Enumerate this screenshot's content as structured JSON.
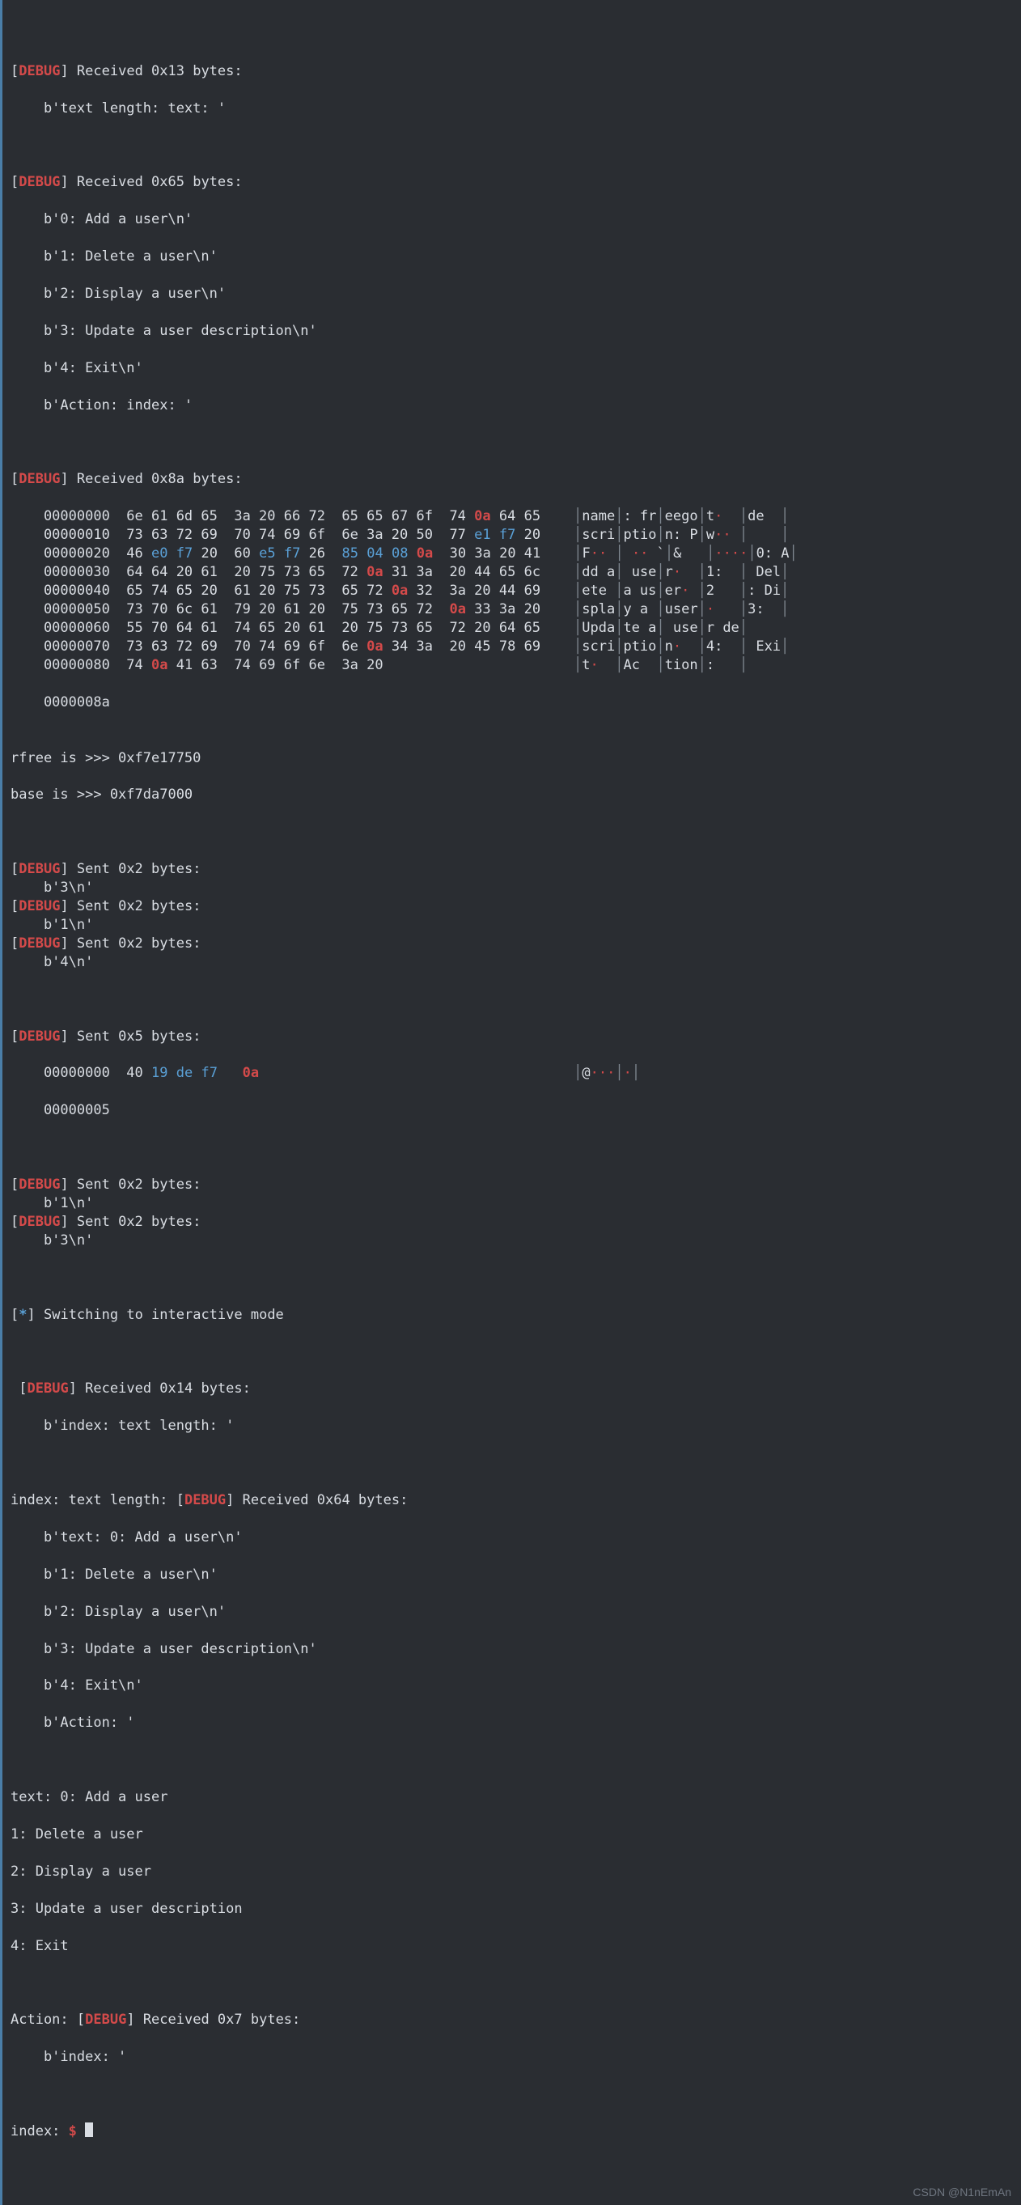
{
  "ansi": {
    "brL": "[",
    "brR": "]",
    "debug": "DEBUG",
    "star": "*"
  },
  "l1": " Received 0x13 bytes:",
  "l1b": "    b'text length: text: '",
  "l2": " Received 0x65 bytes:",
  "menu_raw": [
    "    b'0: Add a user\\n'",
    "    b'1: Delete a user\\n'",
    "    b'2: Display a user\\n'",
    "    b'3: Update a user description\\n'",
    "    b'4: Exit\\n'",
    "    b'Action: index: '"
  ],
  "l3": " Received 0x8a bytes:",
  "hex_rows": [
    {
      "off": "00000000",
      "g": [
        [
          "6e",
          "61",
          "6d",
          "65"
        ],
        [
          "3a",
          "20",
          "66",
          "72"
        ],
        [
          "65",
          "65",
          "67",
          "6f"
        ],
        [
          "74",
          "0a",
          "64",
          "65"
        ]
      ],
      "a": [
        "name",
        ": fr",
        "eego",
        "t",
        "de"
      ]
    },
    {
      "off": "00000010",
      "g": [
        [
          "73",
          "63",
          "72",
          "69"
        ],
        [
          "70",
          "74",
          "69",
          "6f"
        ],
        [
          "6e",
          "3a",
          "20",
          "50"
        ],
        [
          "77",
          "e1",
          "f7",
          "20"
        ]
      ],
      "a": [
        "scri",
        "ptio",
        "n: P",
        "w",
        "  "
      ]
    },
    {
      "off": "00000020",
      "g": [
        [
          "46",
          "e0",
          "f7",
          "20"
        ],
        [
          "60",
          "e5",
          "f7",
          "26"
        ],
        [
          "85",
          "04",
          "08",
          "0a"
        ],
        [
          "30",
          "3a",
          "20",
          "41"
        ]
      ],
      "a": [
        "F",
        " `",
        "&",
        "",
        "0: A"
      ]
    },
    {
      "off": "00000030",
      "g": [
        [
          "64",
          "64",
          "20",
          "61"
        ],
        [
          "20",
          "75",
          "73",
          "65"
        ],
        [
          "72",
          "0a",
          "31",
          "3a"
        ],
        [
          "20",
          "44",
          "65",
          "6c"
        ]
      ],
      "a": [
        "dd a",
        " use",
        "r",
        "1:",
        " Del"
      ]
    },
    {
      "off": "00000040",
      "g": [
        [
          "65",
          "74",
          "65",
          "20"
        ],
        [
          "61",
          "20",
          "75",
          "73"
        ],
        [
          "65",
          "72",
          "0a",
          "32"
        ],
        [
          "3a",
          "20",
          "44",
          "69"
        ]
      ],
      "a": [
        "ete ",
        "a us",
        "er",
        "2",
        ": Di"
      ]
    },
    {
      "off": "00000050",
      "g": [
        [
          "73",
          "70",
          "6c",
          "61"
        ],
        [
          "79",
          "20",
          "61",
          "20"
        ],
        [
          "75",
          "73",
          "65",
          "72"
        ],
        [
          "0a",
          "33",
          "3a",
          "20"
        ]
      ],
      "a": [
        "spla",
        "y a ",
        "user",
        "",
        "3: "
      ]
    },
    {
      "off": "00000060",
      "g": [
        [
          "55",
          "70",
          "64",
          "61"
        ],
        [
          "74",
          "65",
          "20",
          "61"
        ],
        [
          "20",
          "75",
          "73",
          "65"
        ],
        [
          "72",
          "20",
          "64",
          "65"
        ]
      ],
      "a": [
        "Upda",
        "te a",
        " use",
        "r de",
        ""
      ]
    },
    {
      "off": "00000070",
      "g": [
        [
          "73",
          "63",
          "72",
          "69"
        ],
        [
          "70",
          "74",
          "69",
          "6f"
        ],
        [
          "6e",
          "0a",
          "34",
          "3a"
        ],
        [
          "20",
          "45",
          "78",
          "69"
        ]
      ],
      "a": [
        "scri",
        "ptio",
        "n",
        "4:",
        " Exi"
      ]
    },
    {
      "off": "00000080",
      "g": [
        [
          "74",
          "0a",
          "41",
          "63"
        ],
        [
          "74",
          "69",
          "6f",
          "6e"
        ],
        [
          "3a",
          "20",
          "",
          ""
        ],
        [
          "",
          "",
          "",
          ""
        ]
      ],
      "a": [
        "t",
        "Ac",
        "tion",
        ": ",
        ""
      ]
    }
  ],
  "hex_tail_off": "    0000008a",
  "rfree": "rfree is >>> 0xf7e17750",
  "base": "base is >>> 0xf7da7000",
  "sent": [
    {
      "hdr": " Sent 0x2 bytes:",
      "body": "    b'3\\n'"
    },
    {
      "hdr": " Sent 0x2 bytes:",
      "body": "    b'1\\n'"
    },
    {
      "hdr": " Sent 0x2 bytes:",
      "body": "    b'4\\n'"
    }
  ],
  "sent5_hdr": " Sent 0x5 bytes:",
  "sent5_row": {
    "off": "00000000",
    "bytes": [
      "40",
      "19",
      "de",
      "f7",
      "0a"
    ],
    "a": "@"
  },
  "sent5_tail": "    00000005",
  "sent_after": [
    {
      "hdr": " Sent 0x2 bytes:",
      "body": "    b'1\\n'"
    },
    {
      "hdr": " Sent 0x2 bytes:",
      "body": "    b'3\\n'"
    }
  ],
  "switch": " Switching to interactive mode",
  "recv14_hdr": " Received 0x14 bytes:",
  "recv14_body": "    b'index: text length: '",
  "inline_prefix": "index: text length: ",
  "recv64_hdr": " Received 0x64 bytes:",
  "recv64_body": [
    "    b'text: 0: Add a user\\n'",
    "    b'1: Delete a user\\n'",
    "    b'2: Display a user\\n'",
    "    b'3: Update a user description\\n'",
    "    b'4: Exit\\n'",
    "    b'Action: '"
  ],
  "plain_menu": [
    "text: 0: Add a user",
    "1: Delete a user",
    "2: Display a user",
    "3: Update a user description",
    "4: Exit"
  ],
  "action_prefix": "Action: ",
  "recv7_hdr": " Received 0x7 bytes:",
  "recv7_body": "    b'index: '",
  "final_prefix": "index: ",
  "prompt": "$",
  "watermark": "CSDN @N1nEmAn",
  "hex_highlight": {
    "0a": "red",
    "e1": "blue",
    "f7": "blue",
    "e0": "blue",
    "e5": "blue",
    "85": "blue",
    "04": "blue",
    "08": "blue",
    "19": "blue",
    "de": "blue"
  },
  "ascii_colmarks": {
    "00000000": [
      "",
      "",
      "",
      "DOT",
      ""
    ],
    "00000010": [
      "",
      "",
      "",
      "DDOT",
      ""
    ],
    "00000020": [
      "DD",
      " DD",
      "",
      "DDDD",
      ""
    ],
    "00000030": [
      "",
      "",
      "DOT",
      "",
      ""
    ],
    "00000040": [
      "",
      "",
      "DOT",
      "",
      ""
    ],
    "00000050": [
      "",
      "",
      "",
      "DOT",
      ""
    ],
    "00000060": [
      "",
      "",
      "",
      "",
      ""
    ],
    "00000070": [
      "",
      "",
      "DOT",
      "",
      ""
    ],
    "00000080": [
      "DOT",
      "",
      "",
      "",
      ""
    ]
  }
}
